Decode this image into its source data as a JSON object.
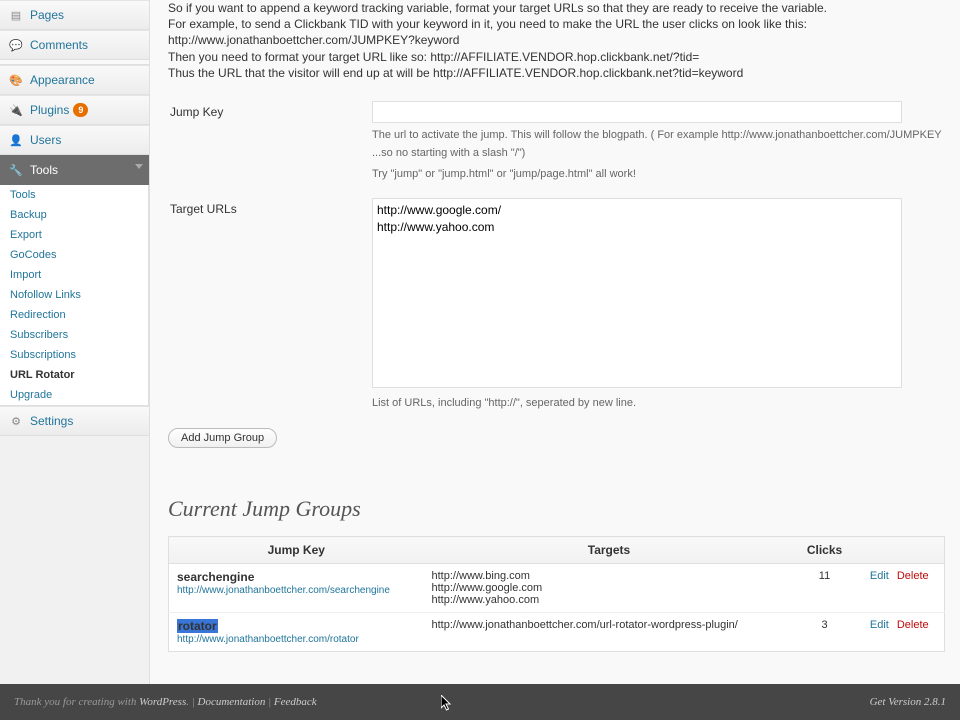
{
  "sidebar": {
    "top": [
      {
        "icon": "▤",
        "label": "Pages"
      },
      {
        "icon": "💬",
        "label": "Comments"
      }
    ],
    "mid": [
      {
        "icon": "🎨",
        "label": "Appearance"
      },
      {
        "icon": "🔌",
        "label": "Plugins",
        "badge": "9"
      },
      {
        "icon": "👤",
        "label": "Users"
      },
      {
        "icon": "🔧",
        "label": "Tools",
        "open": true
      }
    ],
    "tools_sub": [
      "Tools",
      "Backup",
      "Export",
      "GoCodes",
      "Import",
      "Nofollow Links",
      "Redirection",
      "Subscribers",
      "Subscriptions",
      "URL Rotator",
      "Upgrade"
    ],
    "tools_current": "URL Rotator",
    "bottom": [
      {
        "icon": "⚙",
        "label": "Settings"
      }
    ]
  },
  "intro": {
    "l1": "So if you want to append a keyword tracking variable, format your target URLs so that they are ready to receive the variable.",
    "l2": "For example, to send a Clickbank TID with your keyword in it, you need to make the URL the user clicks on look like this:",
    "l3": "http://www.jonathanboettcher.com/JUMPKEY?keyword",
    "l4": "Then you need to format your target URL like so: http://AFFILIATE.VENDOR.hop.clickbank.net/?tid=",
    "l5": "Thus the URL that the visitor will end up at will be http://AFFILIATE.VENDOR.hop.clickbank.net?tid=keyword"
  },
  "form": {
    "jump_key_label": "Jump Key",
    "jump_key_value": "",
    "jump_key_desc1": "The url to activate the jump. This will follow the blogpath. ( For example http://www.jonathanboettcher.com/JUMPKEY ...so no starting with a slash \"/\")",
    "jump_key_desc2": "Try \"jump\" or \"jump.html\" or \"jump/page.html\" all work!",
    "target_label": "Target URLs",
    "target_value": "http://www.google.com/\nhttp://www.yahoo.com",
    "target_desc": "List of URLs, including \"http://\", seperated by new line.",
    "submit": "Add Jump Group"
  },
  "groups": {
    "heading": "Current Jump Groups",
    "cols": {
      "key": "Jump Key",
      "targets": "Targets",
      "clicks": "Clicks"
    },
    "edit": "Edit",
    "delete": "Delete",
    "rows": [
      {
        "key": "searchengine",
        "url": "http://www.jonathanboettcher.com/searchengine",
        "targets": "http://www.bing.com\nhttp://www.google.com\nhttp://www.yahoo.com",
        "clicks": "11",
        "hl": false
      },
      {
        "key": "rotator",
        "url": "http://www.jonathanboettcher.com/rotator",
        "targets": "http://www.jonathanboettcher.com/url-rotator-wordpress-plugin/",
        "clicks": "3",
        "hl": true
      }
    ]
  },
  "footer": {
    "thanks_pre": "Thank you for creating with ",
    "wp": "WordPress",
    "doc": "Documentation",
    "fb": "Feedback",
    "ver": "Get Version 2.8.1"
  }
}
